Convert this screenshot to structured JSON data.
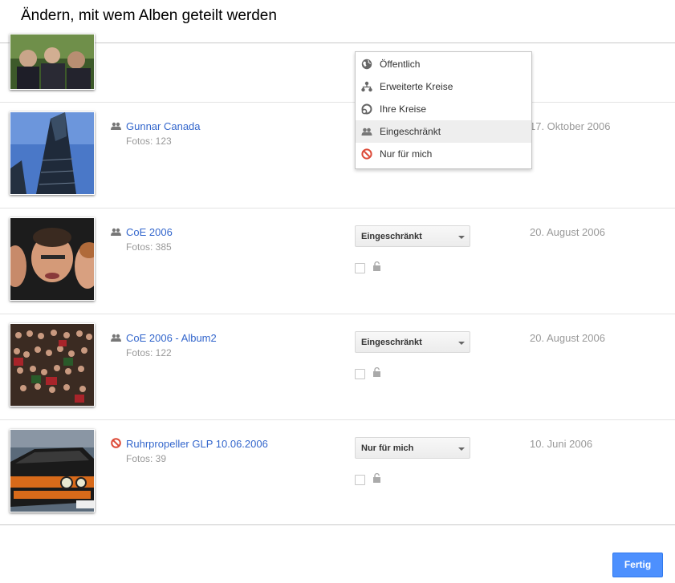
{
  "dialog": {
    "title": "Ändern, mit wem Alben geteilt werden",
    "done_label": "Fertig"
  },
  "dropdown_menu": {
    "options": [
      {
        "label": "Öffentlich",
        "icon": "globe-icon"
      },
      {
        "label": "Erweiterte Kreise",
        "icon": "extended-circles-icon"
      },
      {
        "label": "Ihre Kreise",
        "icon": "circles-icon"
      },
      {
        "label": "Eingeschränkt",
        "icon": "people-icon"
      },
      {
        "label": "Nur für mich",
        "icon": "private-icon"
      }
    ],
    "highlighted": "Eingeschränkt"
  },
  "albums": [
    {
      "title": "",
      "count": "",
      "date": "",
      "visibility": ""
    },
    {
      "title": "Gunnar Canada",
      "count": "Fotos: 123",
      "date": "17. Oktober 2006",
      "visibility": "",
      "icon": "people-icon"
    },
    {
      "title": "CoE 2006",
      "count": "Fotos: 385",
      "date": "20. August 2006",
      "visibility": "Eingeschränkt",
      "icon": "people-icon"
    },
    {
      "title": "CoE 2006 - Album2",
      "count": "Fotos: 122",
      "date": "20. August 2006",
      "visibility": "Eingeschränkt",
      "icon": "people-icon"
    },
    {
      "title": "Ruhrpropeller GLP 10.06.2006",
      "count": "Fotos: 39",
      "date": "10. Juni 2006",
      "visibility": "Nur für mich",
      "icon": "private-icon"
    }
  ],
  "colors": {
    "link": "#3366cc",
    "primary_button": "#4d90fe",
    "private_red": "#dd4b39"
  }
}
